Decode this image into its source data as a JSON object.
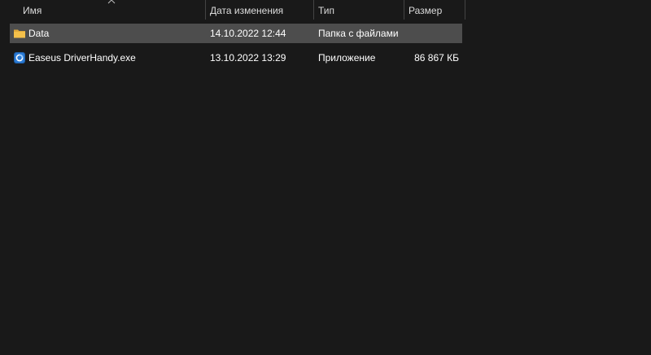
{
  "columns": {
    "name": "Имя",
    "date": "Дата изменения",
    "type": "Тип",
    "size": "Размер"
  },
  "files": [
    {
      "name": "Data",
      "date": "14.10.2022 12:44",
      "type": "Папка с файлами",
      "size": "",
      "icon": "folder-icon",
      "selected": true
    },
    {
      "name": "Easeus DriverHandy.exe",
      "date": "13.10.2022 13:29",
      "type": "Приложение",
      "size": "86 867 КБ",
      "icon": "app-icon",
      "selected": false
    }
  ],
  "colors": {
    "background": "#191919",
    "selected_row": "#4d4d4d",
    "folder": "#f4c04a",
    "app_icon": "#2a7bd6"
  }
}
